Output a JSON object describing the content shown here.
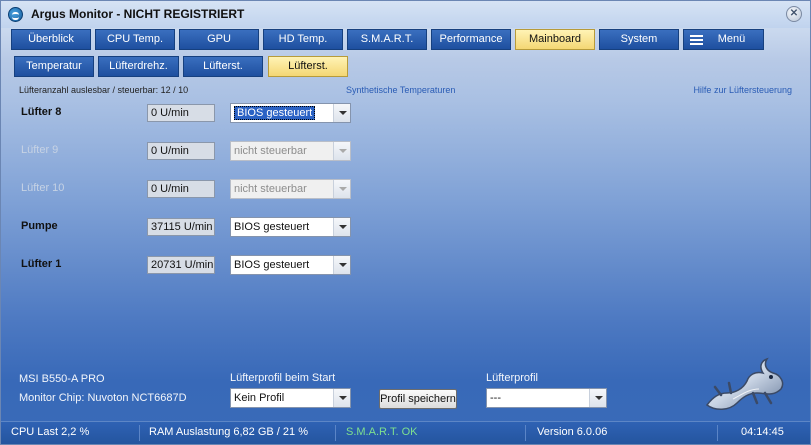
{
  "window": {
    "title": "Argus Monitor - NICHT REGISTRIERT",
    "close_glyph": "✕"
  },
  "tabs": [
    {
      "label": "Überblick",
      "active": false
    },
    {
      "label": "CPU Temp.",
      "active": false
    },
    {
      "label": "GPU",
      "active": false
    },
    {
      "label": "HD Temp.",
      "active": false
    },
    {
      "label": "S.M.A.R.T.",
      "active": false
    },
    {
      "label": "Performance",
      "active": false
    },
    {
      "label": "Mainboard",
      "active": true
    },
    {
      "label": "System",
      "active": false
    },
    {
      "label": "Menü",
      "active": false,
      "icon": "hamburger-menu-icon"
    }
  ],
  "subtabs": [
    {
      "label": "Temperatur",
      "active": false
    },
    {
      "label": "Lüfterdrehz.",
      "active": false
    },
    {
      "label": "Lüfterst.",
      "active": false
    },
    {
      "label": "Lüfterst.",
      "active": true
    }
  ],
  "info": {
    "count_label": "Lüfteranzahl auslesbar / steuerbar: 12 / 10",
    "synthetic_link": "Synthetische Temperaturen",
    "help_link": "Hilfe zur Lüftersteuerung"
  },
  "fans": [
    {
      "name": "Lüfter 8",
      "rpm": "0 U/min",
      "mode": "BIOS gesteuert",
      "enabled": true,
      "focused": true
    },
    {
      "name": "Lüfter 9",
      "rpm": "0 U/min",
      "mode": "nicht steuerbar",
      "enabled": false,
      "focused": false
    },
    {
      "name": "Lüfter 10",
      "rpm": "0 U/min",
      "mode": "nicht steuerbar",
      "enabled": false,
      "focused": false
    },
    {
      "name": "Pumpe",
      "rpm": "37115 U/min",
      "mode": "BIOS gesteuert",
      "enabled": true,
      "focused": false
    },
    {
      "name": "Lüfter 1",
      "rpm": "20731 U/min",
      "mode": "BIOS gesteuert",
      "enabled": true,
      "focused": false
    }
  ],
  "bottom": {
    "board": "MSI B550-A PRO",
    "chip": "Monitor Chip: Nuvoton NCT6687D",
    "start_profile_label": "Lüfterprofil beim Start",
    "start_profile_value": "Kein Profil",
    "save_button": "Profil speichern",
    "profile_label": "Lüfterprofil",
    "profile_value": "---"
  },
  "status": {
    "cpu": "CPU Last 2,2 %",
    "ram": "RAM Auslastung 6,82 GB / 21 %",
    "smart": "S.M.A.R.T. OK",
    "version": "Version 6.0.06",
    "time": "04:14:45"
  },
  "colors": {
    "active_tab": "#f4d774",
    "tab": "#1e4f9f",
    "smart_ok": "#7ee08f"
  }
}
